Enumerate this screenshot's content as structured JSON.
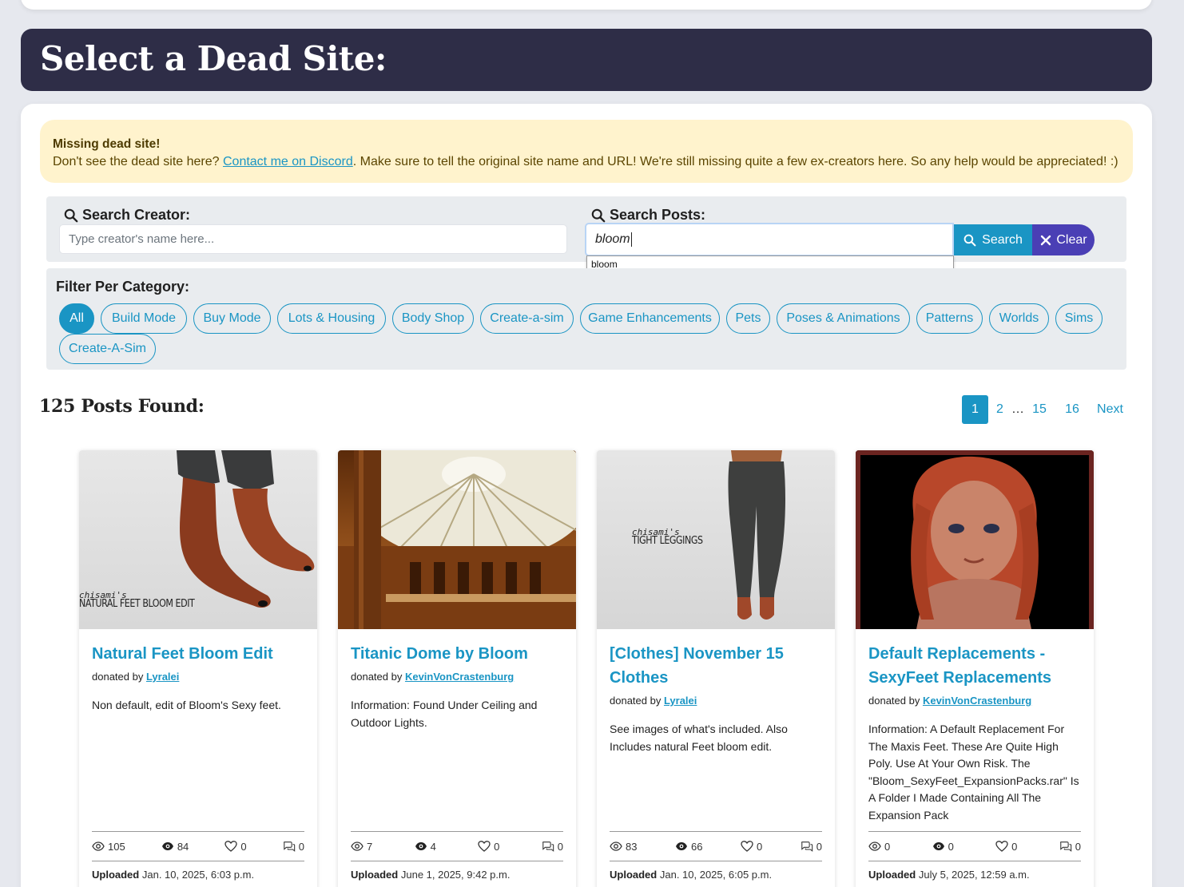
{
  "header": {
    "title": "Select a Dead Site:"
  },
  "alert": {
    "title": "Missing dead site!",
    "text_before": "Don't see the dead site here? ",
    "link": "Contact me on Discord",
    "text_after": ". Make sure to tell the original site name and URL! We're still missing quite a few ex-creators here. So any help would be appreciated! :)"
  },
  "search": {
    "creator_label": "Search Creator:",
    "creator_placeholder": "Type creator's name here...",
    "posts_label": "Search Posts:",
    "posts_value": "bloom",
    "search_button": "Search",
    "clear_button": "Clear",
    "autocomplete": "bloom"
  },
  "filter": {
    "title": "Filter Per Category:",
    "categories": [
      "All",
      "Build Mode",
      "Buy Mode",
      "Lots & Housing",
      "Body Shop",
      "Create-a-sim",
      "Game Enhancements",
      "Pets",
      "Poses & Animations",
      "Patterns",
      "Worlds",
      "Sims",
      "Create-A-Sim"
    ]
  },
  "results": {
    "count_label": "125 Posts Found:"
  },
  "pagination": {
    "items": [
      "1",
      "2",
      "…",
      "15",
      "16",
      "Next"
    ]
  },
  "posts": [
    {
      "title": "Natural Feet Bloom Edit",
      "donated_prefix": "donated by ",
      "donor": "Lyralei",
      "description": "Non default, edit of Bloom's Sexy feet.",
      "views": "105",
      "downloads": "84",
      "likes": "0",
      "comments": "0",
      "uploaded_label": "Uploaded",
      "uploaded": "Jan. 10, 2025, 6:03 p.m.",
      "image_caption_1": "chisami's",
      "image_caption_2": "NATURAL FEET BLOOM EDIT"
    },
    {
      "title": "Titanic Dome by Bloom",
      "donated_prefix": "donated by ",
      "donor": "KevinVonCrastenburg",
      "description": "Information: Found Under Ceiling and Outdoor Lights.",
      "views": "7",
      "downloads": "4",
      "likes": "0",
      "comments": "0",
      "uploaded_label": "Uploaded",
      "uploaded": "June 1, 2025, 9:42 p.m."
    },
    {
      "title": "[Clothes] November 15 Clothes",
      "donated_prefix": "donated by ",
      "donor": "Lyralei",
      "description": "See images of what's included. Also Includes natural Feet bloom edit.",
      "views": "83",
      "downloads": "66",
      "likes": "0",
      "comments": "0",
      "uploaded_label": "Uploaded",
      "uploaded": "Jan. 10, 2025, 6:05 p.m.",
      "image_caption_1": "chisami's",
      "image_caption_2": "TIGHT LEGGINGS"
    },
    {
      "title": "Default Replacements - SexyFeet Replacements",
      "donated_prefix": "donated by ",
      "donor": "KevinVonCrastenburg",
      "description": "Information: A Default Replacement For The Maxis Feet. These Are Quite High Poly. Use At Your Own Risk. The \"Bloom_SexyFeet_ExpansionPacks.rar\" Is A Folder I Made Containing All The Expansion Pack",
      "views": "0",
      "downloads": "0",
      "likes": "0",
      "comments": "0",
      "uploaded_label": "Uploaded",
      "uploaded": "July 5, 2025, 12:59 a.m."
    }
  ],
  "colors": {
    "accent": "#1a95c4",
    "header_bg": "#2e2d47",
    "alert_bg": "#fff3cd",
    "clear_bg": "#4a3fb5"
  },
  "icons": {
    "search": "search-icon",
    "clear": "close-icon",
    "views": "eye-outline-icon",
    "downloads": "eye-filled-icon",
    "likes": "heart-icon",
    "comments": "comments-icon"
  }
}
